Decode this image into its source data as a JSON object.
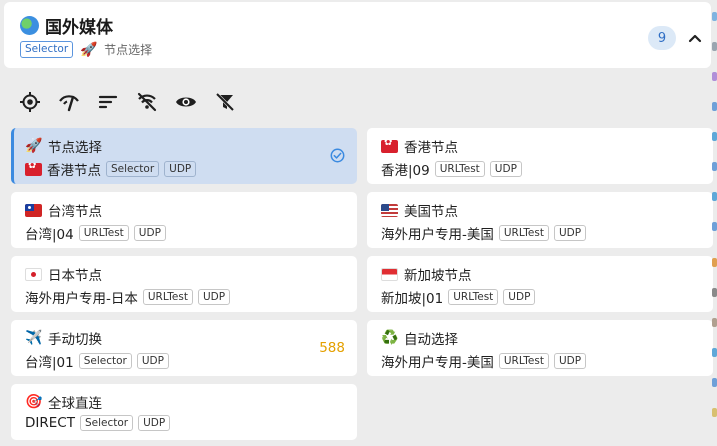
{
  "group": {
    "title": "国外媒体",
    "type_tag": "Selector",
    "current_icon": "🚀",
    "current": "节点选择",
    "count": "9"
  },
  "toolbar": {
    "icons": [
      "locate-icon",
      "speed-test-icon",
      "sort-icon",
      "filter-off-icon",
      "visibility-icon",
      "filter-clear-icon"
    ]
  },
  "nodes": [
    {
      "name": "节点选择",
      "icon": "🚀",
      "sub": "香港节点",
      "sub_flag": "hk",
      "tags": [
        "Selector",
        "UDP"
      ],
      "selected": true
    },
    {
      "name": "香港节点",
      "flag": "hk",
      "sub": "香港|09",
      "tags": [
        "URLTest",
        "UDP"
      ]
    },
    {
      "name": "台湾节点",
      "flag": "tw",
      "sub": "台湾|04",
      "tags": [
        "URLTest",
        "UDP"
      ]
    },
    {
      "name": "美国节点",
      "flag": "us",
      "sub": "海外用户专用-美国",
      "tags": [
        "URLTest",
        "UDP"
      ]
    },
    {
      "name": "日本节点",
      "flag": "jp",
      "sub": "海外用户专用-日本",
      "tags": [
        "URLTest",
        "UDP"
      ]
    },
    {
      "name": "新加坡节点",
      "flag": "sg",
      "sub": "新加坡|01",
      "tags": [
        "URLTest",
        "UDP"
      ]
    },
    {
      "name": "手动切换",
      "icon": "✈️",
      "sub": "台湾|01",
      "tags": [
        "Selector",
        "UDP"
      ],
      "delay": "588"
    },
    {
      "name": "自动选择",
      "icon": "♻️",
      "sub": "海外用户专用-美国",
      "tags": [
        "URLTest",
        "UDP"
      ]
    },
    {
      "name": "全球直连",
      "icon": "🎯",
      "sub": "DIRECT",
      "tags": [
        "Selector",
        "UDP"
      ]
    }
  ],
  "colors": {
    "accent": "#3b8ae0",
    "selected_bg": "#cfddf1",
    "delay": "#e4a000"
  }
}
